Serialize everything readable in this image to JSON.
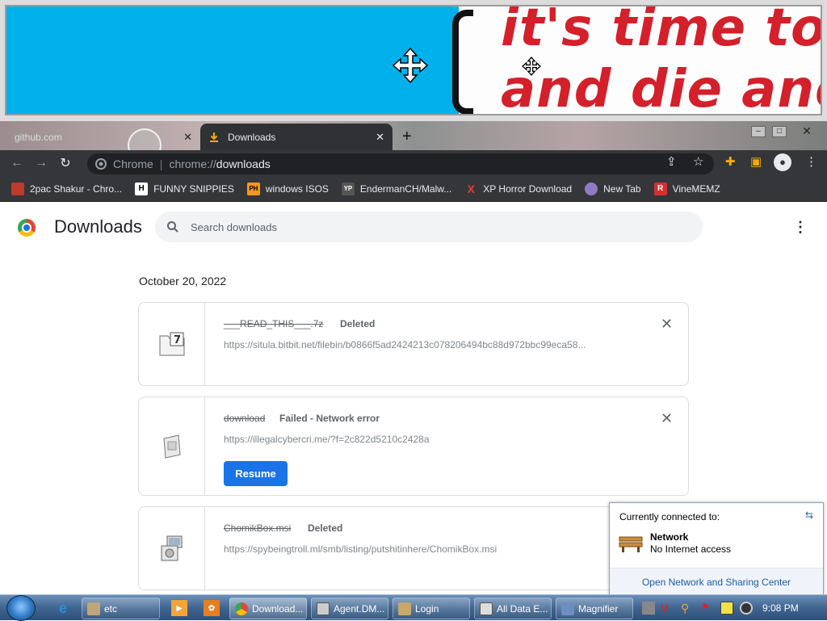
{
  "magnifier": {
    "line1": "it's time to eat",
    "line2": "and die and ch"
  },
  "tabs": [
    {
      "label": "github.com",
      "close": "✕"
    },
    {
      "label": "Downloads",
      "close": "✕"
    }
  ],
  "newtab": "+",
  "window_controls": {
    "close": "✕"
  },
  "omnibox": {
    "chip": "Chrome",
    "sep": "|",
    "scheme": "chrome://",
    "host": "downloads"
  },
  "bookmarks": [
    {
      "label": "2pac Shakur - Chro...",
      "icon_text": "",
      "icon_color": "#c0392b"
    },
    {
      "label": "FUNNY SNIPPIES",
      "icon_text": "H",
      "icon_color": "#ffffff"
    },
    {
      "label": "windows ISOS",
      "icon_text": "PH",
      "icon_color": "#f7971e"
    },
    {
      "label": "EndermanCH/Malw...",
      "icon_text": "YP",
      "icon_color": "#555555"
    },
    {
      "label": "XP Horror Download",
      "icon_text": "X",
      "icon_color": "#e53935"
    },
    {
      "label": "New Tab",
      "icon_text": "",
      "icon_color": "#8e7cc3"
    },
    {
      "label": "VineMEMZ",
      "icon_text": "R",
      "icon_color": "#d32f2f"
    }
  ],
  "page": {
    "title": "Downloads",
    "search_placeholder": "Search downloads",
    "menu": "⋮",
    "date_header": "October 20, 2022"
  },
  "downloads": [
    {
      "name": "___READ_THIS___.7z",
      "status": "Deleted",
      "url": "https://situla.bitbit.net/filebin/b0866f5ad2424213c078206494bc88d972bbc99eca58...",
      "close": "✕"
    },
    {
      "name": "download",
      "status": "Failed - Network error",
      "url": "https://illegalcybercri.me/?f=2c822d5210c2428a",
      "close": "✕",
      "button": "Resume"
    },
    {
      "name": "ChomikBox.msi",
      "status": "Deleted",
      "url": "https://spybeingtroll.ml/smb/listing/putshitinhere/ChomikBox.msi",
      "close": "✕"
    }
  ],
  "network_popup": {
    "header": "Currently connected to:",
    "name": "Network",
    "status": "No Internet access",
    "link": "Open Network and Sharing Center"
  },
  "taskbar": {
    "tasks": [
      "etc",
      "Download...",
      "Agent.DM...",
      "Login",
      "All Data E...",
      "Magnifier"
    ],
    "clock": "9:08 PM"
  }
}
